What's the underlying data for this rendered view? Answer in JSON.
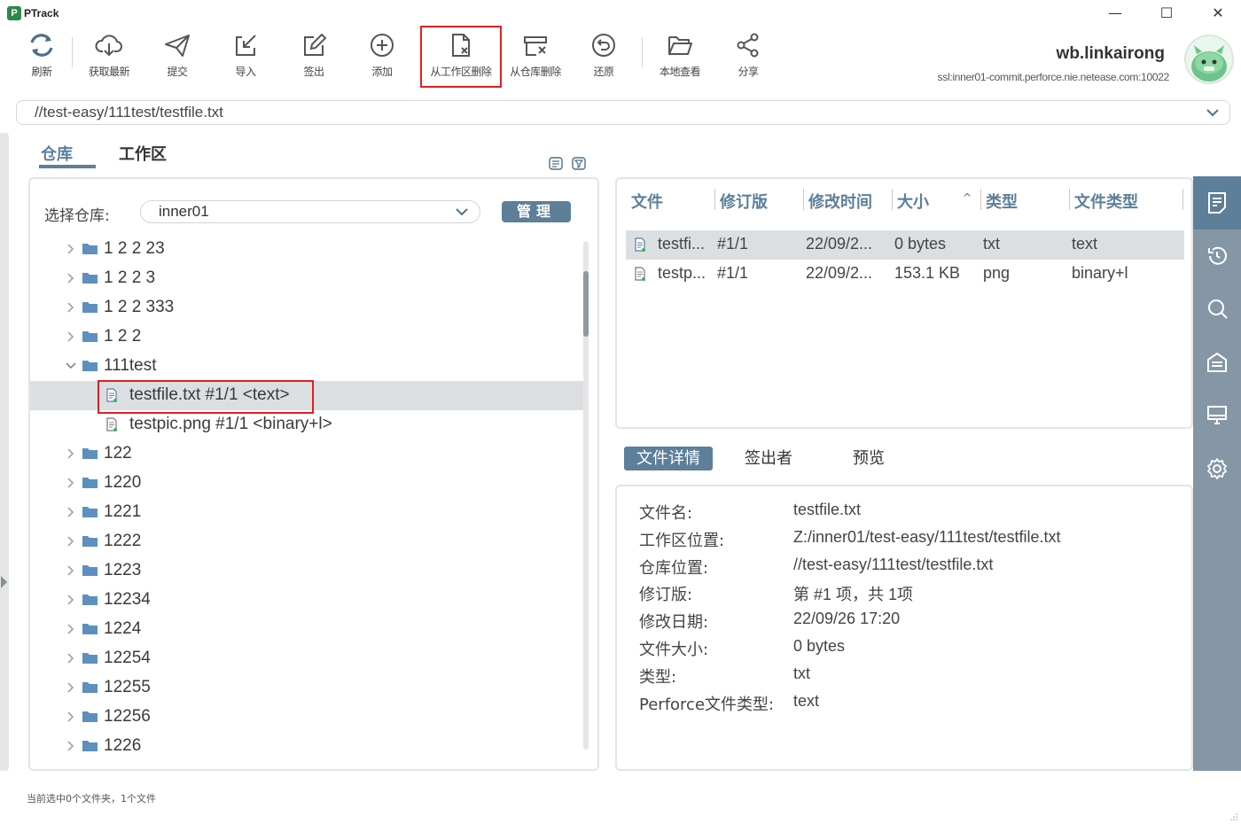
{
  "app": {
    "title": "PTrack",
    "logo_letter": "P"
  },
  "window_controls": {
    "minimize": "—",
    "maximize": "☐",
    "close": "✕"
  },
  "toolbar": {
    "refresh": "刷新",
    "get_latest": "获取最新",
    "submit": "提交",
    "import": "导入",
    "checkout": "签出",
    "add": "添加",
    "delete_from_workspace": "从工作区删除",
    "delete_from_depot": "从仓库删除",
    "revert": "还原",
    "local_view": "本地查看",
    "share": "分享"
  },
  "user": {
    "name": "wb.linkairong",
    "server": "ssl:inner01-commit.perforce.nie.netease.com:10022"
  },
  "path": {
    "value": "//test-easy/111test/testfile.txt"
  },
  "tabs": {
    "repo": "仓库",
    "workspace": "工作区"
  },
  "repo_selector": {
    "label": "选择仓库:",
    "value": "inner01",
    "manage_button": "管理"
  },
  "tree": {
    "folders_before": [
      {
        "label": "1 2 2 23"
      },
      {
        "label": "1 2 2 3"
      },
      {
        "label": "1 2 2 333"
      },
      {
        "label": "1 2 2"
      }
    ],
    "expanded_folder": {
      "label": "111test"
    },
    "files": [
      {
        "label": "testfile.txt  #1/1  <text>"
      },
      {
        "label": "testpic.png  #1/1  <binary+l>"
      }
    ],
    "folders_after": [
      {
        "label": "122"
      },
      {
        "label": "1220"
      },
      {
        "label": "1221"
      },
      {
        "label": "1222"
      },
      {
        "label": "1223"
      },
      {
        "label": "12234"
      },
      {
        "label": "1224"
      },
      {
        "label": "12254"
      },
      {
        "label": "12255"
      },
      {
        "label": "12256"
      },
      {
        "label": "1226"
      }
    ]
  },
  "file_table": {
    "headers": {
      "file": "文件",
      "revision": "修订版",
      "modified": "修改时间",
      "size": "大小",
      "sort_indicator": "^",
      "type": "类型",
      "filetype": "文件类型"
    },
    "rows": [
      {
        "file": "testfi...",
        "revision": "#1/1",
        "modified": "22/09/2...",
        "size": "0 bytes",
        "type": "txt",
        "filetype": "text"
      },
      {
        "file": "testp...",
        "revision": "#1/1",
        "modified": "22/09/2...",
        "size": "153.1 KB",
        "type": "png",
        "filetype": "binary+l"
      }
    ]
  },
  "detail_tabs": {
    "details": "文件详情",
    "checked_out_by": "签出者",
    "preview": "预览"
  },
  "details": [
    {
      "label": "文件名:",
      "value": "testfile.txt"
    },
    {
      "label": "工作区位置:",
      "value": "Z:/inner01/test-easy/111test/testfile.txt"
    },
    {
      "label": "仓库位置:",
      "value": "//test-easy/111test/testfile.txt"
    },
    {
      "label": "修订版:",
      "value": "第 #1 项，共 1项"
    },
    {
      "label": "修改日期:",
      "value": "22/09/26 17:20"
    },
    {
      "label": "文件大小:",
      "value": "0 bytes"
    },
    {
      "label": "类型:",
      "value": "txt"
    },
    {
      "label": "Perforce文件类型:",
      "value": "text"
    }
  ],
  "status": {
    "text": "当前选中0个文件夹，1个文件"
  },
  "colors": {
    "accent": "#5d7f99",
    "highlight": "#e02020",
    "sidebar": "#8597a6",
    "selected_row": "#dcdfe2"
  }
}
